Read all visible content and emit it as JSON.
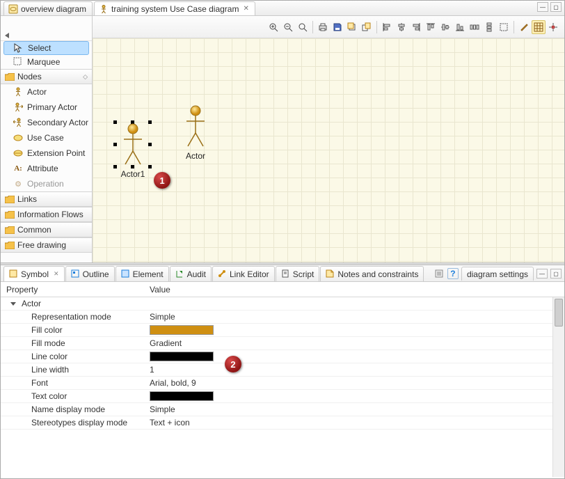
{
  "tabs": {
    "first": "overview diagram",
    "second": "training system Use Case diagram"
  },
  "palette": {
    "tools": {
      "select": "Select",
      "marquee": "Marquee"
    },
    "drawers": {
      "nodes": "Nodes",
      "links": "Links",
      "flows": "Information Flows",
      "common": "Common",
      "free": "Free drawing"
    },
    "nodes": [
      "Actor",
      "Primary Actor",
      "Secondary Actor",
      "Use Case",
      "Extension Point",
      "Attribute",
      "Operation"
    ]
  },
  "canvas": {
    "actor1": "Actor1",
    "actor2": "Actor"
  },
  "lowerTabs": {
    "symbol": "Symbol",
    "outline": "Outline",
    "element": "Element",
    "audit": "Audit",
    "link": "Link Editor",
    "script": "Script",
    "notes": "Notes and constraints",
    "settings": "diagram settings"
  },
  "props": {
    "head_prop": "Property",
    "head_val": "Value",
    "group": "Actor",
    "repr_mode_k": "Representation mode",
    "repr_mode_v": "Simple",
    "fill_color_k": "Fill color",
    "fill_color_v": "#cf8f12",
    "fill_mode_k": "Fill mode",
    "fill_mode_v": "Gradient",
    "line_color_k": "Line color",
    "line_color_v": "#000000",
    "line_width_k": "Line width",
    "line_width_v": "1",
    "font_k": "Font",
    "font_v": "Arial, bold, 9",
    "text_color_k": "Text color",
    "text_color_v": "#000000",
    "name_disp_k": "Name display mode",
    "name_disp_v": "Simple",
    "stereo_k": "Stereotypes display mode",
    "stereo_v": "Text + icon"
  },
  "callouts": {
    "one": "1",
    "two": "2"
  }
}
